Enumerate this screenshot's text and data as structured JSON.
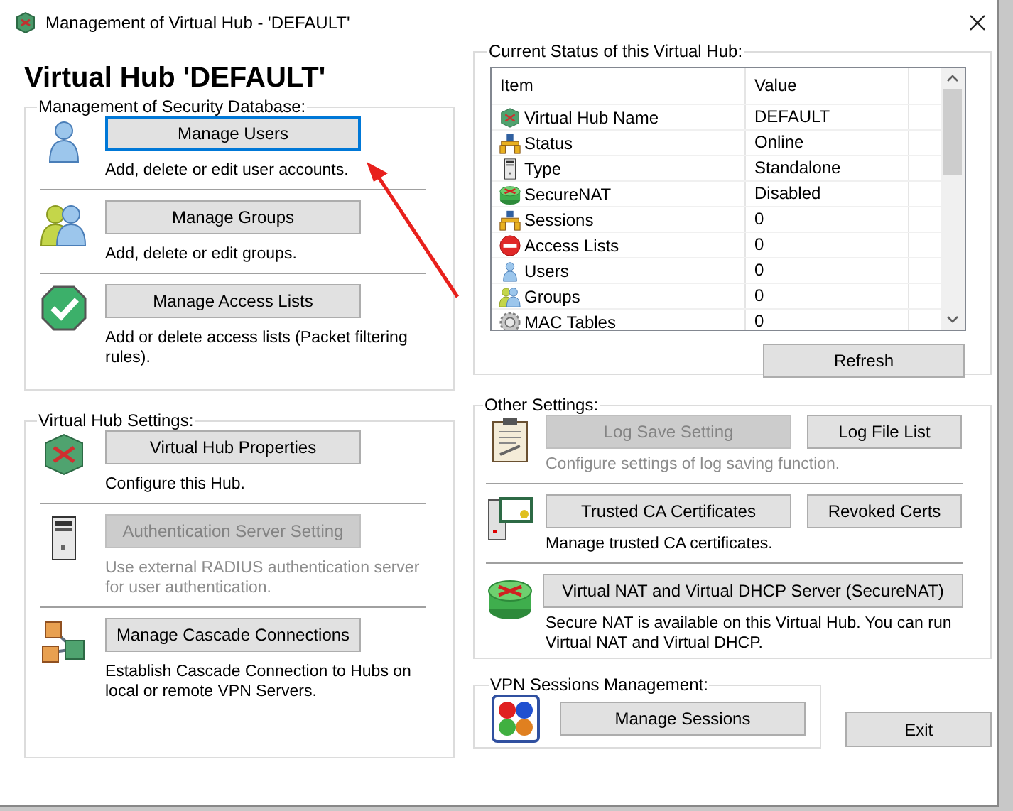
{
  "window": {
    "title": "Management of Virtual Hub - 'DEFAULT'"
  },
  "heading": "Virtual Hub 'DEFAULT'",
  "security_database": {
    "label": "Management of Security Database:",
    "items": [
      {
        "kind": "user",
        "button": "Manage Users",
        "disabled": false,
        "focused": true,
        "description": "Add, delete or edit user accounts."
      },
      {
        "kind": "groups",
        "button": "Manage Groups",
        "disabled": false,
        "focused": false,
        "description": "Add, delete or edit groups."
      },
      {
        "kind": "check",
        "button": "Manage Access Lists",
        "disabled": false,
        "focused": false,
        "description": "Add or delete access lists (Packet filtering rules)."
      }
    ]
  },
  "hub_settings": {
    "label": "Virtual Hub Settings:",
    "items": [
      {
        "kind": "hub",
        "button": "Virtual Hub Properties",
        "disabled": false,
        "focused": false,
        "description": "Configure this Hub."
      },
      {
        "kind": "server",
        "button": "Authentication Server Setting",
        "disabled": true,
        "focused": false,
        "description": "Use external RADIUS authentication server for user authentication."
      },
      {
        "kind": "cascade",
        "button": "Manage Cascade Connections",
        "disabled": false,
        "focused": false,
        "description": "Establish Cascade Connection to Hubs on local or remote VPN Servers."
      }
    ]
  },
  "status": {
    "label": "Current Status of this Virtual Hub:",
    "columns": [
      "Item",
      "Value"
    ],
    "rows": [
      {
        "kind": "hub",
        "item": "Virtual Hub Name",
        "value": "DEFAULT"
      },
      {
        "kind": "network",
        "item": "Status",
        "value": "Online"
      },
      {
        "kind": "server",
        "item": "Type",
        "value": "Standalone"
      },
      {
        "kind": "nat",
        "item": "SecureNAT",
        "value": "Disabled"
      },
      {
        "kind": "network",
        "item": "Sessions",
        "value": "0"
      },
      {
        "kind": "stop",
        "item": "Access Lists",
        "value": "0"
      },
      {
        "kind": "user",
        "item": "Users",
        "value": "0"
      },
      {
        "kind": "groups",
        "item": "Groups",
        "value": "0"
      },
      {
        "kind": "gear",
        "item": "MAC Tables",
        "value": "0"
      }
    ],
    "refresh_button": "Refresh"
  },
  "other_settings": {
    "label": "Other Settings:",
    "items": [
      {
        "kind": "log",
        "buttons": [
          {
            "label": "Log Save Setting",
            "disabled": true
          },
          {
            "label": "Log File List",
            "disabled": false
          }
        ],
        "description": "Configure settings of log saving function.",
        "disabled": true
      },
      {
        "kind": "cert",
        "buttons": [
          {
            "label": "Trusted CA Certificates",
            "disabled": false
          },
          {
            "label": "Revoked Certs",
            "disabled": false
          }
        ],
        "description": "Manage trusted CA certificates.",
        "disabled": false
      },
      {
        "kind": "nat",
        "buttons": [
          {
            "label": "Virtual NAT and Virtual DHCP Server (SecureNAT)",
            "disabled": false
          }
        ],
        "description": "Secure NAT is available on this Virtual Hub. You can run Virtual NAT and Virtual DHCP.",
        "disabled": false
      }
    ]
  },
  "vpn_sessions": {
    "label": "VPN Sessions Management:",
    "button": "Manage Sessions"
  },
  "exit_button": "Exit"
}
